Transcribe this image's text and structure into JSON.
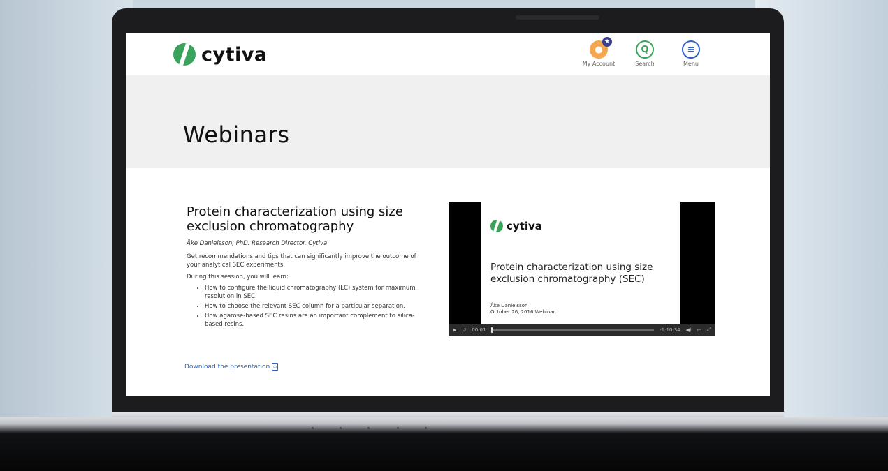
{
  "header": {
    "logo_text": "cytiva",
    "nav": [
      {
        "label": "My Account",
        "icon": "account-icon"
      },
      {
        "label": "Search",
        "icon": "search-icon"
      },
      {
        "label": "Menu",
        "icon": "menu-icon"
      }
    ]
  },
  "banner": {
    "title": "Webinars"
  },
  "webinar": {
    "title": "Protein characterization using size exclusion chromatography",
    "author": "Åke Danielsson, PhD. Research Director, Cytiva",
    "description": "Get recommendations and tips that can significantly improve the outcome of your analytical SEC experiments.",
    "learn_intro": "During this session, you will learn:",
    "points": [
      "How to configure the liquid chromatography (LC) system for maximum resolution in SEC.",
      "How to choose the relevant SEC column for a particular separation.",
      "How agarose-based SEC resins are an important complement to silica-based resins."
    ],
    "download_label": "Download the presentation"
  },
  "video": {
    "logo_text": "cytiva",
    "slide_title": "Protein characterization using size exclusion chromatography (SEC)",
    "slide_author": "Åke Danielsson",
    "slide_date": "October 26, 2016 Webinar",
    "elapsed": "00:01",
    "remaining": "-1:10:34"
  },
  "colors": {
    "brand_green": "#3aa35b",
    "link_blue": "#2b64c2",
    "account_orange": "#f5a651"
  }
}
